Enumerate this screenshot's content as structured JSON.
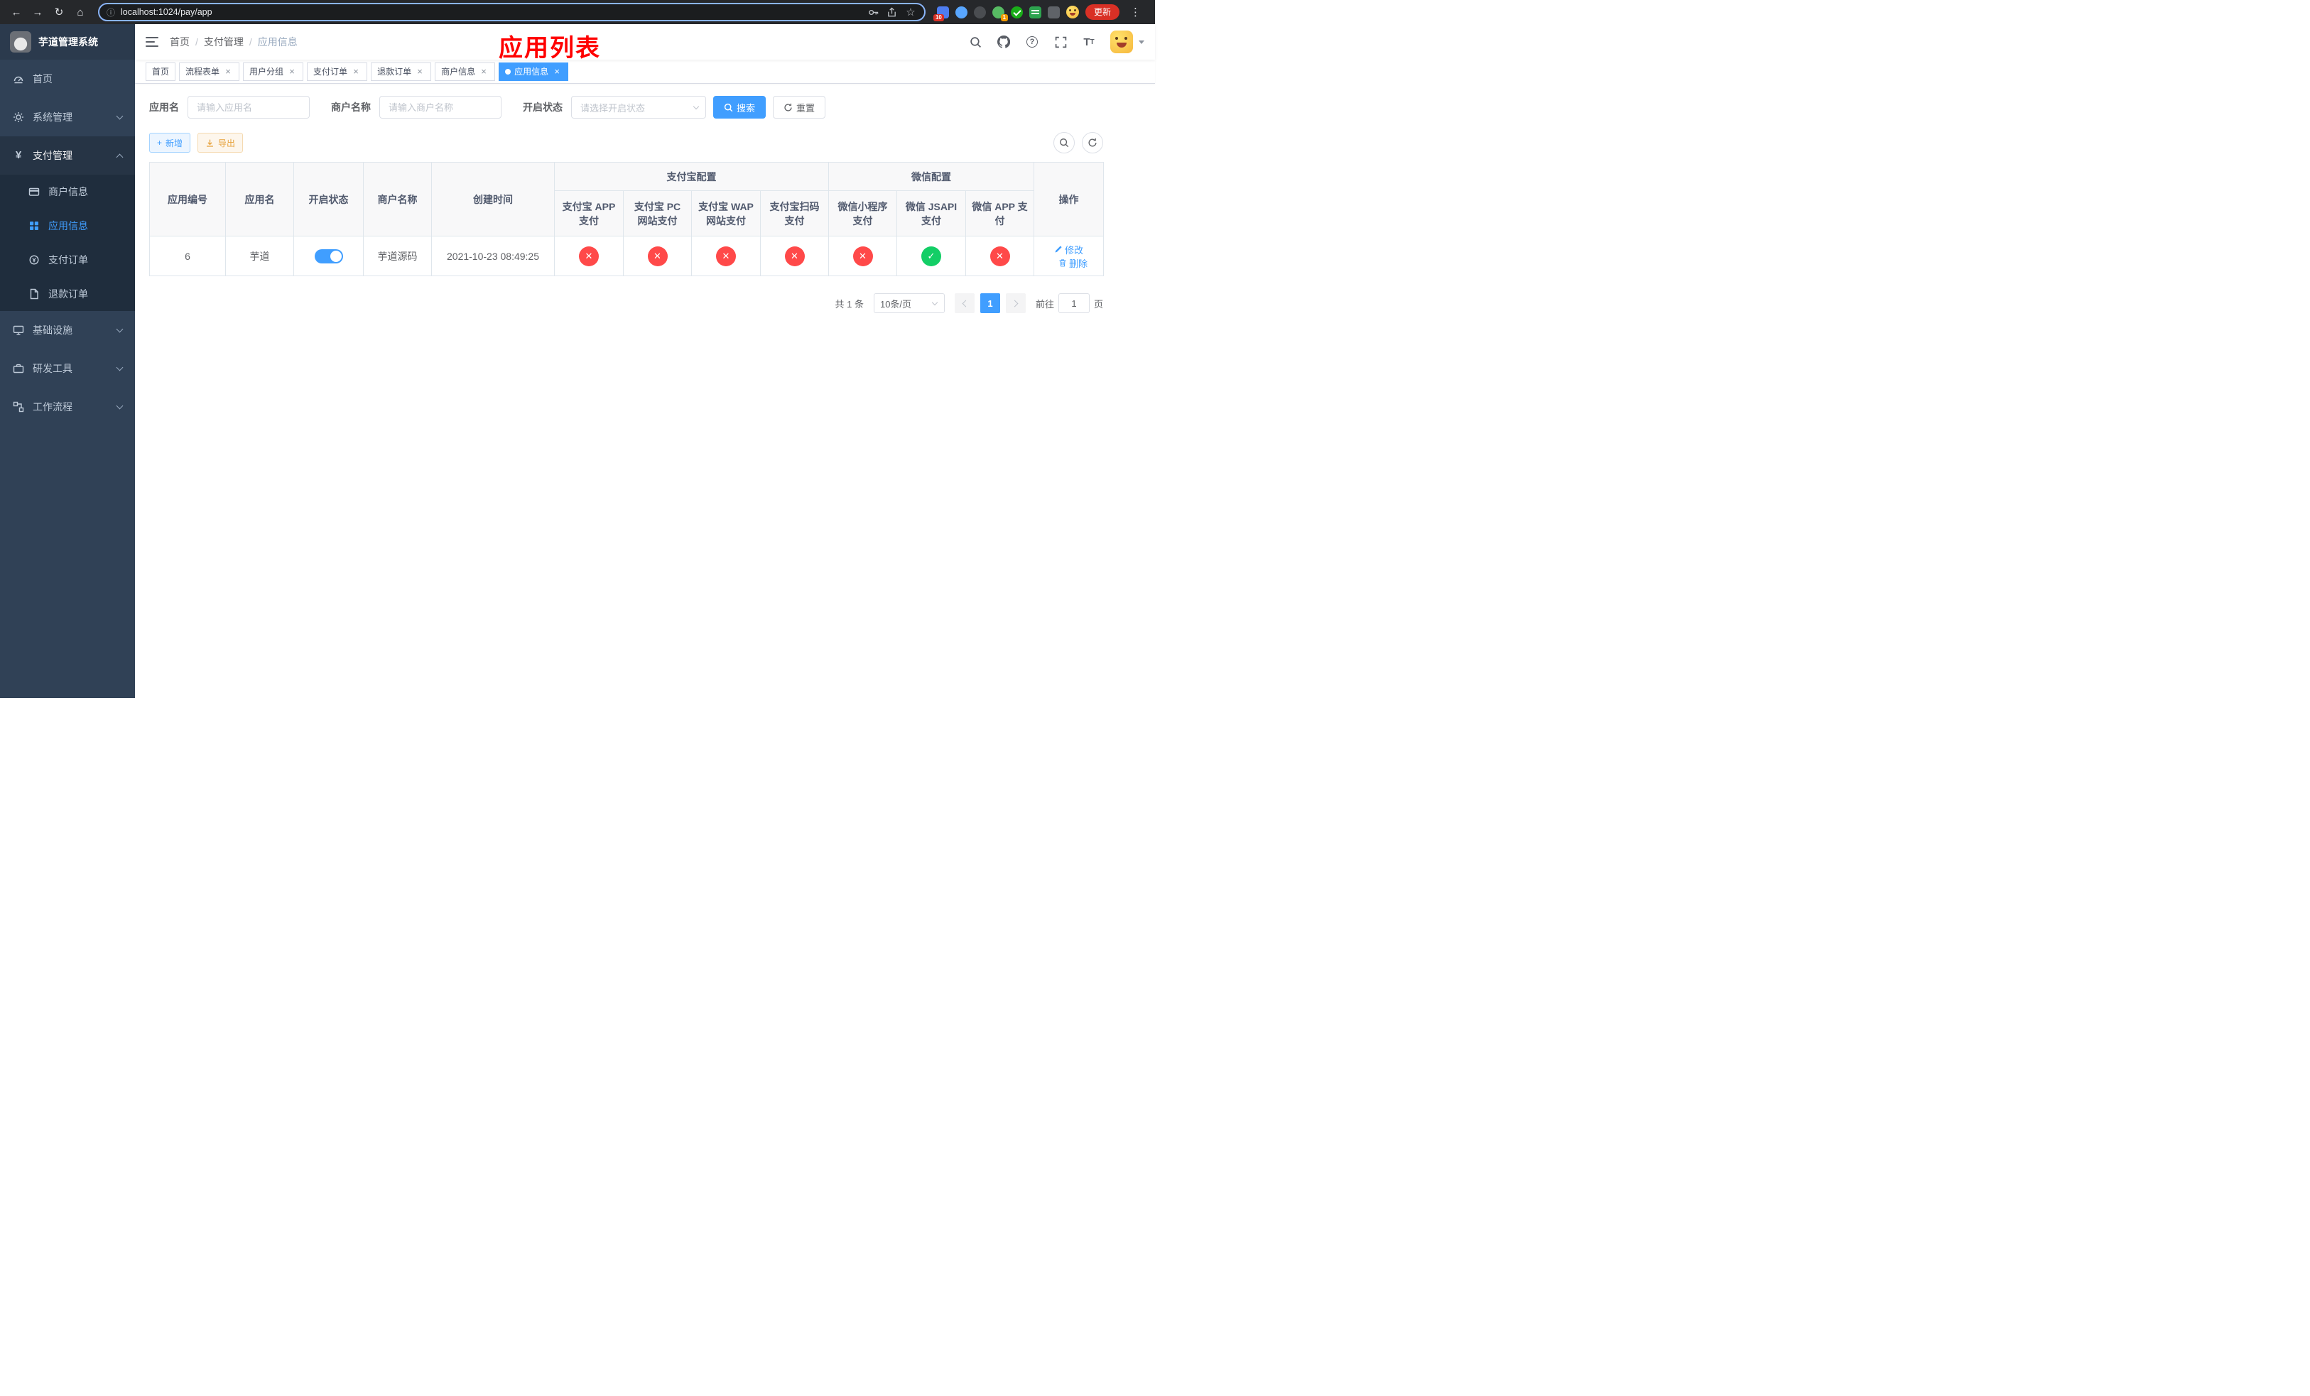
{
  "colors": {
    "accent": "#409eff",
    "danger": "#ff4949",
    "success": "#13ce66",
    "annotation": "#ff0000",
    "warning": "#e6a23c"
  },
  "browser": {
    "url": "localhost:1024/pay/app",
    "update_label": "更新",
    "badge_extensions": "10",
    "badge_avatar": "1"
  },
  "icons": {
    "back": "←",
    "forward": "→",
    "reload": "↻",
    "home": "⌂",
    "info": "ⓘ",
    "star": "☆",
    "more": "⋮",
    "close": "×",
    "check": "✓",
    "cross": "✕",
    "plus": "+",
    "yen": "¥",
    "question": "?",
    "font_big": "T",
    "font_small": "T"
  },
  "annotation": {
    "title": "应用列表"
  },
  "sidebar": {
    "title": "芋道管理系统",
    "items": {
      "home": "首页",
      "system": "系统管理",
      "payment": "支付管理",
      "merchant": "商户信息",
      "app": "应用信息",
      "pay_order": "支付订单",
      "refund_order": "退款订单",
      "infra": "基础设施",
      "dev_tools": "研发工具",
      "workflow": "工作流程"
    }
  },
  "breadcrumb": {
    "items": [
      "首页",
      "支付管理",
      "应用信息"
    ],
    "sep": "/"
  },
  "tags": [
    {
      "label": "首页"
    },
    {
      "label": "流程表单"
    },
    {
      "label": "用户分组"
    },
    {
      "label": "支付订单"
    },
    {
      "label": "退款订单"
    },
    {
      "label": "商户信息"
    },
    {
      "label": "应用信息"
    }
  ],
  "filters": {
    "app_name_label": "应用名",
    "app_name_placeholder": "请输入应用名",
    "merchant_label": "商户名称",
    "merchant_placeholder": "请输入商户名称",
    "status_label": "开启状态",
    "status_placeholder": "请选择开启状态",
    "search_label": "搜索",
    "reset_label": "重置"
  },
  "toolbar": {
    "add_label": "新增",
    "export_label": "导出"
  },
  "table": {
    "col_app_id": "应用编号",
    "col_app_name": "应用名",
    "col_status": "开启状态",
    "col_merchant": "商户名称",
    "col_created": "创建时间",
    "group_alipay": "支付宝配置",
    "group_wechat": "微信配置",
    "col_actions": "操作",
    "sub_cols": [
      "支付宝 APP 支付",
      "支付宝 PC 网站支付",
      "支付宝 WAP 网站支付",
      "支付宝扫码支付",
      "微信小程序支付",
      "微信 JSAPI 支付",
      "微信 APP 支付"
    ],
    "row": {
      "app_id": "6",
      "app_name": "芋道",
      "status_on": true,
      "merchant": "芋道源码",
      "created_at": "2021-10-23 08:49:25",
      "configs": [
        false,
        false,
        false,
        false,
        false,
        true,
        false
      ],
      "edit_label": "修改",
      "delete_label": "删除"
    }
  },
  "pagination": {
    "total": "共 1 条",
    "page_size": "10条/页",
    "current_page": "1",
    "goto_label": "前往",
    "goto_value": "1",
    "page_unit": "页"
  }
}
